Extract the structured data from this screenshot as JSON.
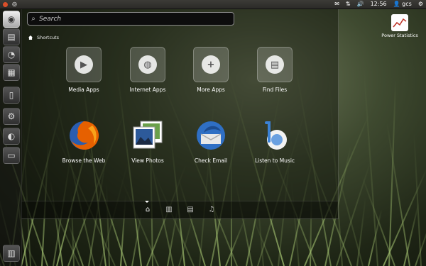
{
  "panel": {
    "user": "gcs",
    "clock": "12:56"
  },
  "search": {
    "placeholder": "Search"
  },
  "section": {
    "label": "Shortcuts"
  },
  "shortcuts": [
    {
      "label": "Media Apps",
      "icon": "media-play-icon"
    },
    {
      "label": "Internet Apps",
      "icon": "globe-icon"
    },
    {
      "label": "More Apps",
      "icon": "plus-icon"
    },
    {
      "label": "Find Files",
      "icon": "document-icon"
    }
  ],
  "apps": [
    {
      "label": "Browse the Web",
      "icon": "firefox-icon"
    },
    {
      "label": "View Photos",
      "icon": "photos-icon"
    },
    {
      "label": "Check Email",
      "icon": "thunderbird-icon"
    },
    {
      "label": "Listen to Music",
      "icon": "banshee-icon"
    }
  ],
  "lenses": [
    "home-icon",
    "apps-lens-icon",
    "files-lens-icon",
    "music-lens-icon"
  ],
  "desktop": {
    "icon_label": "Power Statistics"
  },
  "colors": {
    "panel": "#3c3b37",
    "firefox_orange": "#e66000",
    "thunderbird_blue": "#2f6fc4"
  }
}
